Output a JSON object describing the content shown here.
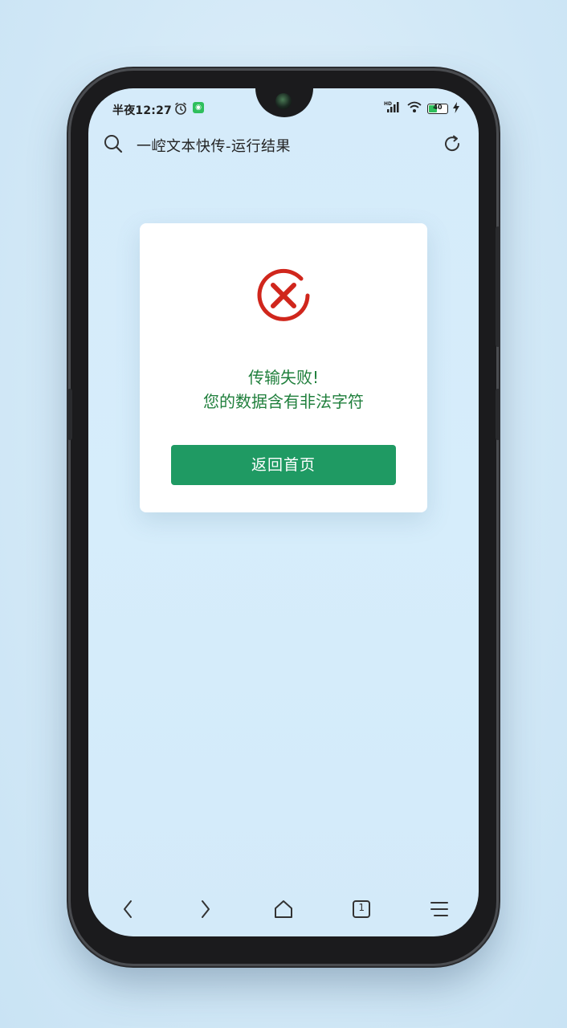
{
  "status_bar": {
    "time": "半夜12:27",
    "battery_level": "40",
    "icons": [
      "alarm-icon",
      "app-notification-icon",
      "hd-signal-icon",
      "wifi-icon",
      "battery-icon",
      "charging-icon"
    ]
  },
  "browser": {
    "title": "一崆文本快传-运行结果",
    "search_icon": "search-icon",
    "refresh_icon": "refresh-icon"
  },
  "dialog": {
    "icon": "error-x-icon",
    "line1": "传输失败!",
    "line2": "您的数据含有非法字符",
    "button_label": "返回首页",
    "accent": "#1f9a63",
    "error_color": "#d0261c",
    "text_color": "#1f7f3c"
  },
  "bottom_nav": {
    "tabs_count": "1",
    "icons": [
      "back-icon",
      "forward-icon",
      "home-icon",
      "tabs-icon",
      "menu-icon"
    ]
  }
}
